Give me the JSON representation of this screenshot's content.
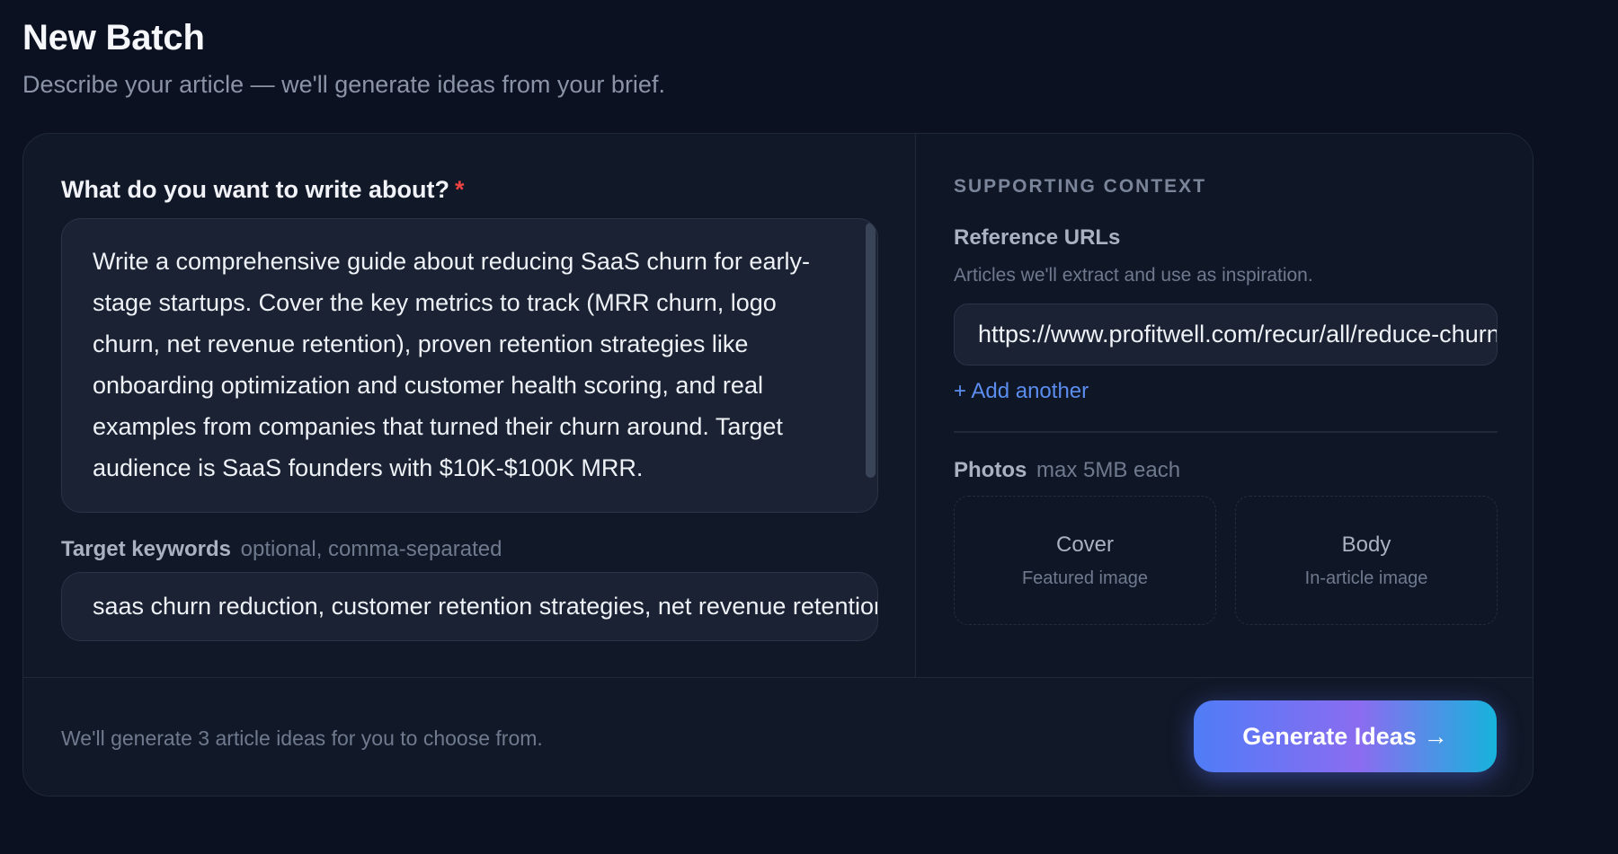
{
  "header": {
    "title": "New Batch",
    "subtitle": "Describe your article — we'll generate ideas from your brief."
  },
  "main": {
    "topic_label": "What do you want to write about?",
    "required_marker": "*",
    "topic_value": "Write a comprehensive guide about reducing SaaS churn for early-stage startups. Cover the key metrics to track (MRR churn, logo churn, net revenue retention), proven retention strategies like onboarding optimization and customer health scoring, and real examples from companies that turned their churn around. Target audience is SaaS founders with $10K-$100K MRR.",
    "keywords_label": "Target keywords",
    "keywords_hint": "optional, comma-separated",
    "keywords_value": "saas churn reduction, customer retention strategies, net revenue retention"
  },
  "side": {
    "heading": "SUPPORTING CONTEXT",
    "reference_label": "Reference URLs",
    "reference_hint": "Articles we'll extract and use as inspiration.",
    "reference_url_value": "https://www.profitwell.com/recur/all/reduce-churn",
    "add_another_label": "+ Add another",
    "photos_label": "Photos",
    "photos_hint": "max 5MB each",
    "cover": {
      "title": "Cover",
      "subtitle": "Featured image"
    },
    "body": {
      "title": "Body",
      "subtitle": "In-article image"
    }
  },
  "footer": {
    "note": "We'll generate 3 article ideas for you to choose from.",
    "generate_label": "Generate Ideas",
    "generate_arrow": "→"
  },
  "colors": {
    "background": "#0b1120",
    "card": "#111827",
    "accent": "#5b8def",
    "required": "#ef4444",
    "button_gradient_start": "#4f7cf7",
    "button_gradient_mid": "#8b6cf0",
    "button_gradient_end": "#17b3dc"
  }
}
